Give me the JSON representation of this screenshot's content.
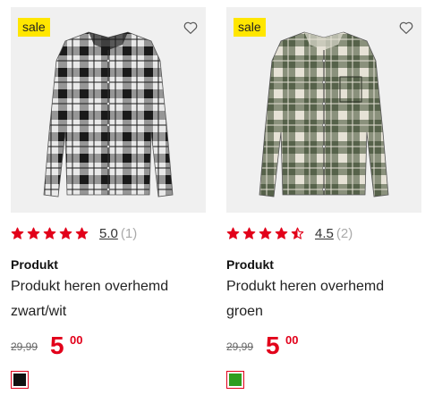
{
  "products": [
    {
      "badge": "sale",
      "rating_value": 5.0,
      "rating_text": "5.0",
      "review_count": "(1)",
      "brand": "Produkt",
      "title": "Produkt heren overhemd zwart/wit",
      "old_price": "29,99",
      "price_euros": "5",
      "price_cents": "00",
      "swatch_color": "#111111",
      "shirt_colors": {
        "base": "#e9e9e9",
        "check": "#1a1a1a",
        "mid": "#7a7a7a"
      }
    },
    {
      "badge": "sale",
      "rating_value": 4.5,
      "rating_text": "4.5",
      "review_count": "(2)",
      "brand": "Produkt",
      "title": "Produkt heren overhemd groen",
      "old_price": "29,99",
      "price_euros": "5",
      "price_cents": "00",
      "swatch_color": "#2f9e1f",
      "shirt_colors": {
        "base": "#56624a",
        "check": "#e6e2d6",
        "mid": "#9aa08c"
      }
    }
  ],
  "colors": {
    "sale_badge": "#ffe600",
    "price_red": "#e2001a",
    "star_red": "#e2001a",
    "image_bg": "#f0f0f0"
  },
  "icons": {
    "wishlist": "heart-outline-icon",
    "rating": "star-icon"
  }
}
